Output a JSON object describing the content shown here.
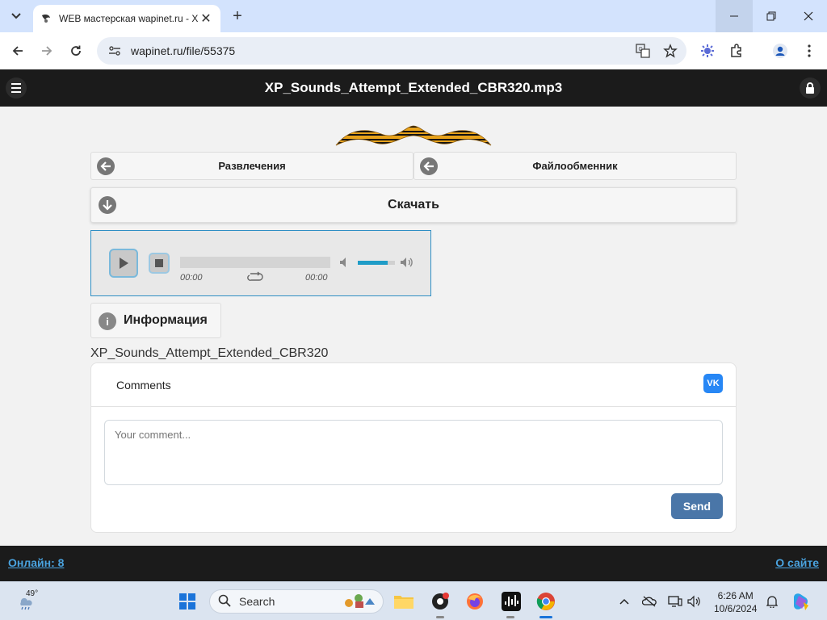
{
  "browser": {
    "tab_title": "WEB мастерская wapinet.ru - X",
    "url": "wapinet.ru/file/55375",
    "new_tab_label": "+"
  },
  "site": {
    "header_title": "XP_Sounds_Attempt_Extended_CBR320.mp3",
    "nav_left": "Развлечения",
    "nav_right": "Файлообменник",
    "download": "Скачать",
    "info_tab": "Информация",
    "filename": "XP_Sounds_Attempt_Extended_CBR320",
    "footer_left": "Онлайн: 8",
    "footer_right": "О сайте"
  },
  "player": {
    "time_current": "00:00",
    "time_total": "00:00",
    "volume_fraction": 0.8,
    "accent": "#1f9cc7"
  },
  "comments": {
    "title": "Comments",
    "placeholder": "Your comment...",
    "send": "Send",
    "vk_label": "VK"
  },
  "taskbar": {
    "weather_temp": "49°",
    "search_label": "Search",
    "time": "6:26 AM",
    "date": "10/6/2024"
  },
  "icons": [
    "tab-search-icon",
    "minimize-icon",
    "maximize-icon",
    "close-icon",
    "back-icon",
    "forward-icon",
    "reload-icon",
    "site-info-icon",
    "translate-icon",
    "star-icon",
    "extension-icon",
    "profile-icon",
    "menu-icon",
    "lock-icon",
    "arrow-left-icon",
    "download-icon",
    "play-icon",
    "stop-icon",
    "repeat-icon",
    "mute-icon",
    "volume-icon",
    "info-icon",
    "windows-start-icon",
    "file-explorer-icon",
    "firefox-icon",
    "chrome-icon",
    "wifi-icon",
    "speaker-icon",
    "bell-icon"
  ]
}
